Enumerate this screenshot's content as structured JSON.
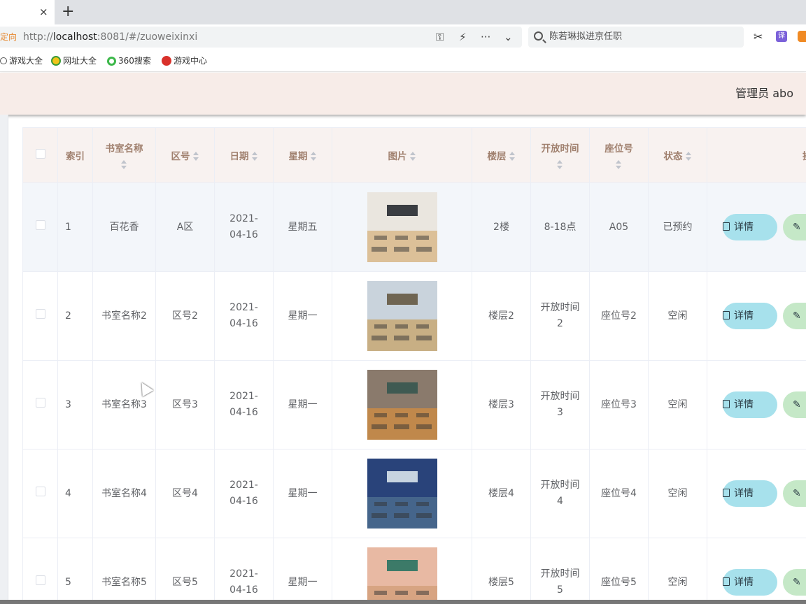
{
  "browser": {
    "tab_close": "×",
    "new_tab": "+",
    "redirect_label": "定向",
    "url_prefix": "http://",
    "url_host": "localhost",
    "url_path": ":8081/#/zuoweixinxi",
    "search_text": "陈若琳拟进京任职",
    "translate_label": "译",
    "bookmarks": [
      "游戏大全",
      "网址大全",
      "360搜索",
      "游戏中心"
    ]
  },
  "header": {
    "role": "管理员",
    "username": "abo"
  },
  "table": {
    "columns": [
      "索引",
      "书室名称",
      "区号",
      "日期",
      "星期",
      "图片",
      "楼层",
      "开放时间",
      "座位号",
      "状态",
      "操作"
    ],
    "detail_label": "详情",
    "rows": [
      {
        "index": "1",
        "name": "百花香",
        "area": "A区",
        "date": "2021-04-16",
        "weekday": "星期五",
        "floor": "2楼",
        "open": "8-18点",
        "seat": "A05",
        "status": "已预约"
      },
      {
        "index": "2",
        "name": "书室名称2",
        "area": "区号2",
        "date": "2021-04-16",
        "weekday": "星期一",
        "floor": "楼层2",
        "open": "开放时间2",
        "seat": "座位号2",
        "status": "空闲"
      },
      {
        "index": "3",
        "name": "书室名称3",
        "area": "区号3",
        "date": "2021-04-16",
        "weekday": "星期一",
        "floor": "楼层3",
        "open": "开放时间3",
        "seat": "座位号3",
        "status": "空闲"
      },
      {
        "index": "4",
        "name": "书室名称4",
        "area": "区号4",
        "date": "2021-04-16",
        "weekday": "星期一",
        "floor": "楼层4",
        "open": "开放时间4",
        "seat": "座位号4",
        "status": "空闲"
      },
      {
        "index": "5",
        "name": "书室名称5",
        "area": "区号5",
        "date": "2021-04-16",
        "weekday": "星期一",
        "floor": "楼层5",
        "open": "开放时间5",
        "seat": "座位号5",
        "status": "空闲"
      }
    ]
  },
  "colors": {
    "header_bg": "#f7ece8",
    "th_text": "#a0806e",
    "detail_btn": "#a7e1ec",
    "edit_btn": "#c5e8c7"
  }
}
